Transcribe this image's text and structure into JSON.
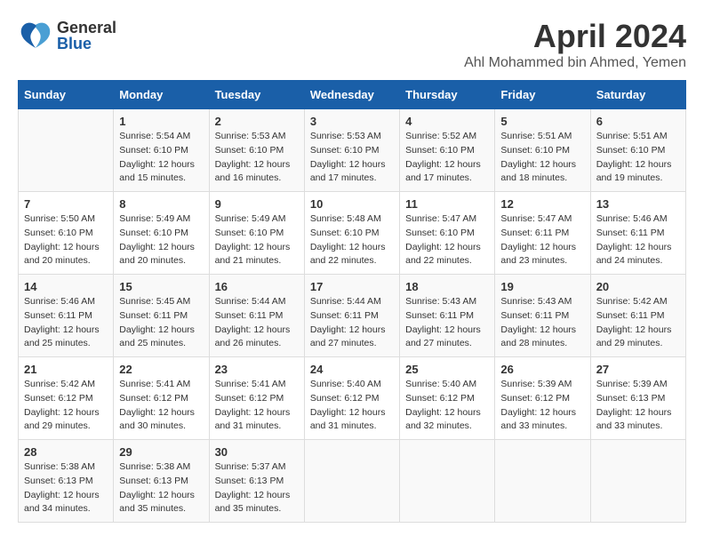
{
  "header": {
    "logo_general": "General",
    "logo_blue": "Blue",
    "title": "April 2024",
    "subtitle": "Ahl Mohammed bin Ahmed, Yemen"
  },
  "columns": [
    "Sunday",
    "Monday",
    "Tuesday",
    "Wednesday",
    "Thursday",
    "Friday",
    "Saturday"
  ],
  "weeks": [
    [
      {
        "day": "",
        "info": ""
      },
      {
        "day": "1",
        "info": "Sunrise: 5:54 AM\nSunset: 6:10 PM\nDaylight: 12 hours\nand 15 minutes."
      },
      {
        "day": "2",
        "info": "Sunrise: 5:53 AM\nSunset: 6:10 PM\nDaylight: 12 hours\nand 16 minutes."
      },
      {
        "day": "3",
        "info": "Sunrise: 5:53 AM\nSunset: 6:10 PM\nDaylight: 12 hours\nand 17 minutes."
      },
      {
        "day": "4",
        "info": "Sunrise: 5:52 AM\nSunset: 6:10 PM\nDaylight: 12 hours\nand 17 minutes."
      },
      {
        "day": "5",
        "info": "Sunrise: 5:51 AM\nSunset: 6:10 PM\nDaylight: 12 hours\nand 18 minutes."
      },
      {
        "day": "6",
        "info": "Sunrise: 5:51 AM\nSunset: 6:10 PM\nDaylight: 12 hours\nand 19 minutes."
      }
    ],
    [
      {
        "day": "7",
        "info": "Sunrise: 5:50 AM\nSunset: 6:10 PM\nDaylight: 12 hours\nand 20 minutes."
      },
      {
        "day": "8",
        "info": "Sunrise: 5:49 AM\nSunset: 6:10 PM\nDaylight: 12 hours\nand 20 minutes."
      },
      {
        "day": "9",
        "info": "Sunrise: 5:49 AM\nSunset: 6:10 PM\nDaylight: 12 hours\nand 21 minutes."
      },
      {
        "day": "10",
        "info": "Sunrise: 5:48 AM\nSunset: 6:10 PM\nDaylight: 12 hours\nand 22 minutes."
      },
      {
        "day": "11",
        "info": "Sunrise: 5:47 AM\nSunset: 6:10 PM\nDaylight: 12 hours\nand 22 minutes."
      },
      {
        "day": "12",
        "info": "Sunrise: 5:47 AM\nSunset: 6:11 PM\nDaylight: 12 hours\nand 23 minutes."
      },
      {
        "day": "13",
        "info": "Sunrise: 5:46 AM\nSunset: 6:11 PM\nDaylight: 12 hours\nand 24 minutes."
      }
    ],
    [
      {
        "day": "14",
        "info": "Sunrise: 5:46 AM\nSunset: 6:11 PM\nDaylight: 12 hours\nand 25 minutes."
      },
      {
        "day": "15",
        "info": "Sunrise: 5:45 AM\nSunset: 6:11 PM\nDaylight: 12 hours\nand 25 minutes."
      },
      {
        "day": "16",
        "info": "Sunrise: 5:44 AM\nSunset: 6:11 PM\nDaylight: 12 hours\nand 26 minutes."
      },
      {
        "day": "17",
        "info": "Sunrise: 5:44 AM\nSunset: 6:11 PM\nDaylight: 12 hours\nand 27 minutes."
      },
      {
        "day": "18",
        "info": "Sunrise: 5:43 AM\nSunset: 6:11 PM\nDaylight: 12 hours\nand 27 minutes."
      },
      {
        "day": "19",
        "info": "Sunrise: 5:43 AM\nSunset: 6:11 PM\nDaylight: 12 hours\nand 28 minutes."
      },
      {
        "day": "20",
        "info": "Sunrise: 5:42 AM\nSunset: 6:11 PM\nDaylight: 12 hours\nand 29 minutes."
      }
    ],
    [
      {
        "day": "21",
        "info": "Sunrise: 5:42 AM\nSunset: 6:12 PM\nDaylight: 12 hours\nand 29 minutes."
      },
      {
        "day": "22",
        "info": "Sunrise: 5:41 AM\nSunset: 6:12 PM\nDaylight: 12 hours\nand 30 minutes."
      },
      {
        "day": "23",
        "info": "Sunrise: 5:41 AM\nSunset: 6:12 PM\nDaylight: 12 hours\nand 31 minutes."
      },
      {
        "day": "24",
        "info": "Sunrise: 5:40 AM\nSunset: 6:12 PM\nDaylight: 12 hours\nand 31 minutes."
      },
      {
        "day": "25",
        "info": "Sunrise: 5:40 AM\nSunset: 6:12 PM\nDaylight: 12 hours\nand 32 minutes."
      },
      {
        "day": "26",
        "info": "Sunrise: 5:39 AM\nSunset: 6:12 PM\nDaylight: 12 hours\nand 33 minutes."
      },
      {
        "day": "27",
        "info": "Sunrise: 5:39 AM\nSunset: 6:13 PM\nDaylight: 12 hours\nand 33 minutes."
      }
    ],
    [
      {
        "day": "28",
        "info": "Sunrise: 5:38 AM\nSunset: 6:13 PM\nDaylight: 12 hours\nand 34 minutes."
      },
      {
        "day": "29",
        "info": "Sunrise: 5:38 AM\nSunset: 6:13 PM\nDaylight: 12 hours\nand 35 minutes."
      },
      {
        "day": "30",
        "info": "Sunrise: 5:37 AM\nSunset: 6:13 PM\nDaylight: 12 hours\nand 35 minutes."
      },
      {
        "day": "",
        "info": ""
      },
      {
        "day": "",
        "info": ""
      },
      {
        "day": "",
        "info": ""
      },
      {
        "day": "",
        "info": ""
      }
    ]
  ]
}
